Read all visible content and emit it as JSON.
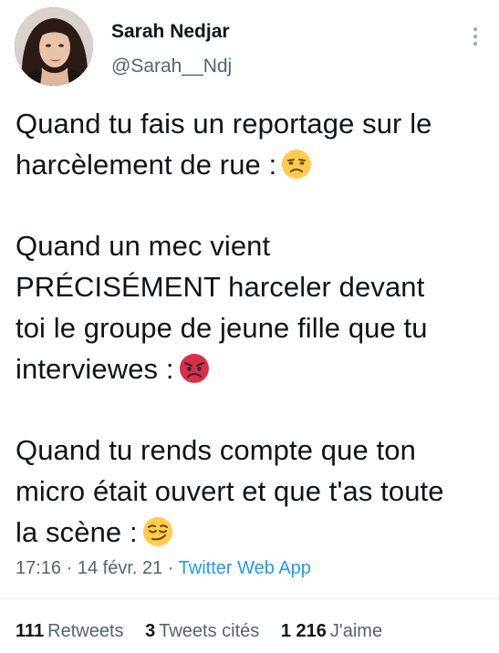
{
  "author": {
    "display_name": "Sarah Nedjar",
    "handle": "@Sarah__Ndj"
  },
  "tweet": {
    "paragraph1_line1": "Quand tu fais un reportage sur le",
    "paragraph1_line2": "harcèlement de rue :",
    "paragraph1_emoji": "unamused-face-emoji",
    "paragraph2_line1": "Quand un mec vient",
    "paragraph2_line2": "PRÉCISÉMENT harceler devant",
    "paragraph2_line3": "toi le groupe de jeune fille que tu",
    "paragraph2_line4": "interviewes :",
    "paragraph2_emoji": "angry-face-emoji",
    "paragraph3_line1": "Quand tu rends compte que ton",
    "paragraph3_line2": "micro était ouvert et que t'as toute",
    "paragraph3_line3": "la scène :",
    "paragraph3_emoji": "smirking-face-emoji"
  },
  "meta": {
    "time": "17:16",
    "separator": " · ",
    "date": "14 févr. 21",
    "source": "Twitter Web App"
  },
  "stats": {
    "retweets_count": "111",
    "retweets_label": "Retweets",
    "quotes_count": "3",
    "quotes_label": "Tweets cités",
    "likes_count": "1 216",
    "likes_label": "J'aime"
  },
  "colors": {
    "text": "#0f1419",
    "secondary": "#536471",
    "link": "#1d9bf0"
  }
}
